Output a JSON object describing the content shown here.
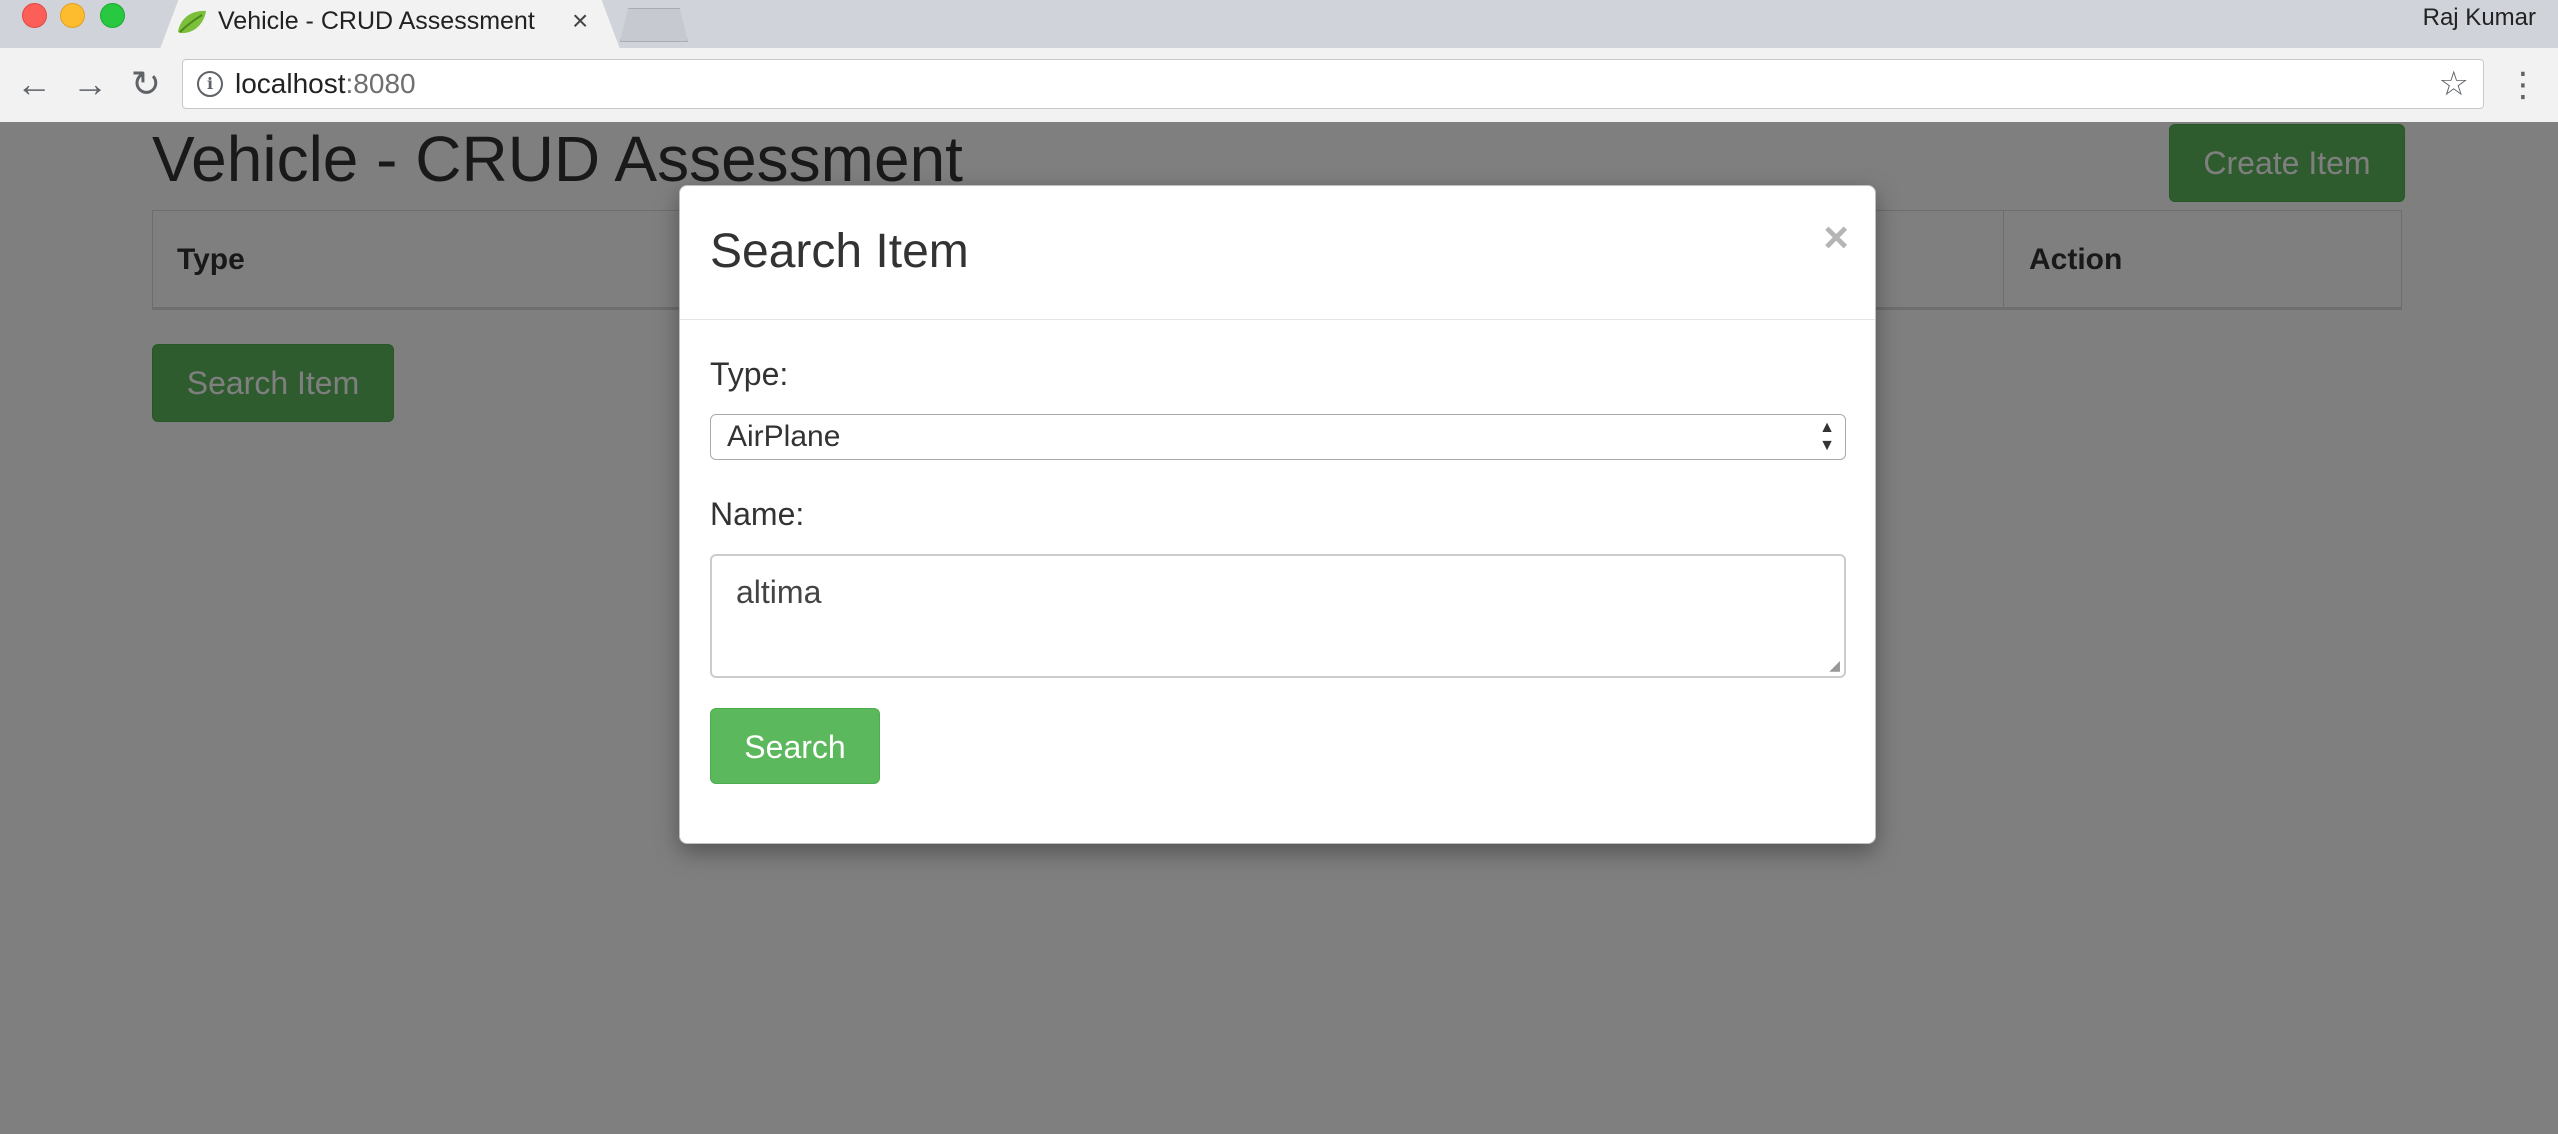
{
  "browser": {
    "tab_title": "Vehicle - CRUD Assessment",
    "tab_close": "×",
    "profile_name": "Raj Kumar",
    "url_host": "localhost",
    "url_port": ":8080"
  },
  "page": {
    "title": "Vehicle - CRUD Assessment",
    "create_button": "Create Item",
    "table_headers": {
      "type": "Type",
      "action": "Action"
    },
    "search_button": "Search Item"
  },
  "modal": {
    "title": "Search Item",
    "close": "×",
    "type_label": "Type:",
    "type_value": "AirPlane",
    "name_label": "Name:",
    "name_value": "altima",
    "search_button": "Search"
  },
  "colors": {
    "button_green": "#5cb85c",
    "backdrop": "rgba(0,0,0,0.5)"
  }
}
